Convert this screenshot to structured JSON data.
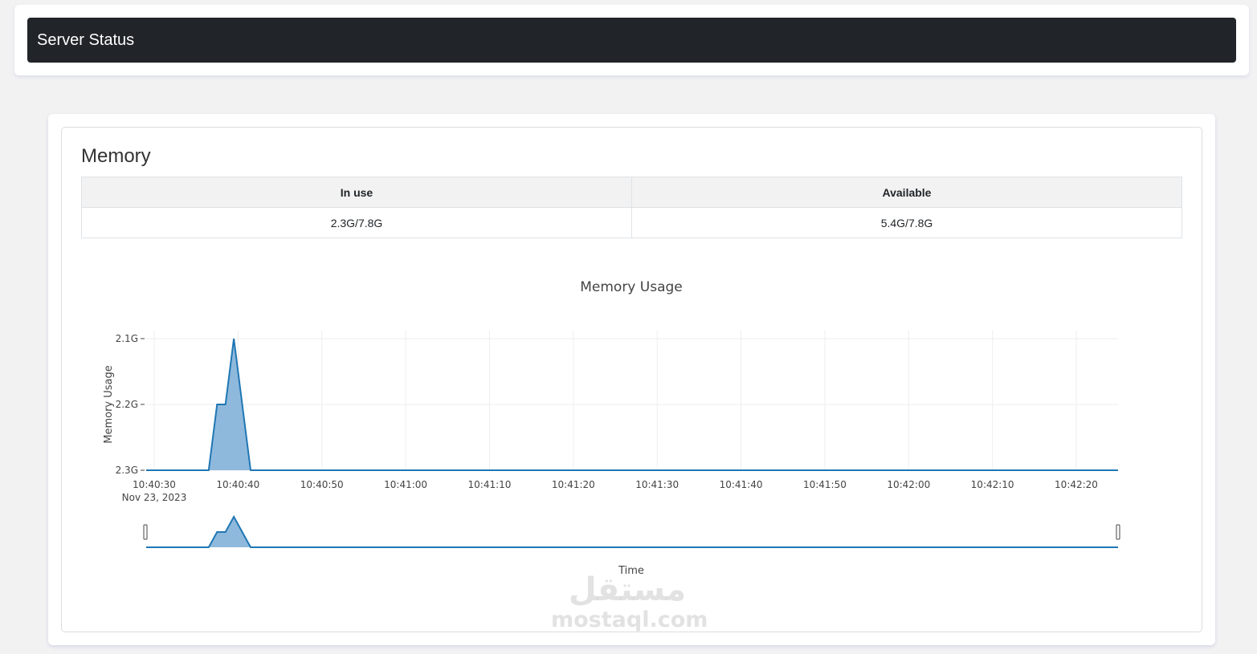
{
  "header": {
    "brand": "Server Status"
  },
  "memory": {
    "title": "Memory",
    "columns": [
      "In use",
      "Available"
    ],
    "row": [
      "2.3G/7.8G",
      "5.4G/7.8G"
    ]
  },
  "chart_data": {
    "type": "area",
    "title": "Memory Usage",
    "xlabel": "Time",
    "ylabel": "Memory Usage",
    "x_ticks": [
      "10:40:30",
      "10:40:40",
      "10:40:50",
      "10:41:00",
      "10:41:10",
      "10:41:20",
      "10:41:30",
      "10:41:40",
      "10:41:50",
      "10:42:00",
      "10:42:10",
      "10:42:20"
    ],
    "x_date_label": "Nov 23, 2023",
    "y_ticks": [
      "2.1G",
      "2.2G",
      "2.3G"
    ],
    "x_range_seconds": [
      0,
      115
    ],
    "y_range": [
      2.3,
      2.1
    ],
    "series": [
      {
        "color": "#1f77b4",
        "fill": "#8fb9dc",
        "x_seconds": [
          0,
          6.5,
          7.5,
          8.5,
          9.5,
          11.5,
          115
        ],
        "y": [
          2.3,
          2.3,
          2.2,
          2.2,
          2.1,
          2.3,
          2.3
        ]
      }
    ],
    "rangeslider": true,
    "grid": true
  },
  "watermark": {
    "arabic": "مستقل",
    "latin": "mostaql.com"
  }
}
